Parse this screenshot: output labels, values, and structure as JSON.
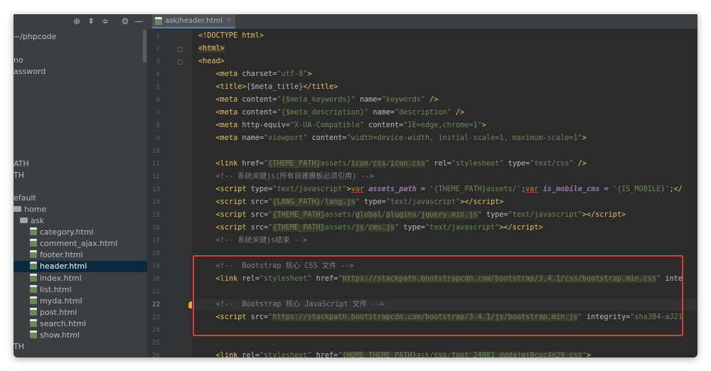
{
  "tab": {
    "label": "ask/header.html"
  },
  "project_tree": [
    {
      "label": "~/phpcode",
      "kind": "text"
    },
    {
      "label": "no",
      "kind": "text"
    },
    {
      "label": "assword",
      "kind": "text"
    },
    {
      "label": "ATH",
      "kind": "text"
    },
    {
      "label": "TH",
      "kind": "text"
    },
    {
      "label": "efault",
      "kind": "text"
    },
    {
      "label": "home",
      "kind": "folder"
    },
    {
      "label": "ask",
      "kind": "folder"
    },
    {
      "label": "category.html",
      "kind": "html"
    },
    {
      "label": "comment_ajax.html",
      "kind": "html"
    },
    {
      "label": "footer.html",
      "kind": "html"
    },
    {
      "label": "header.html",
      "kind": "html",
      "selected": true
    },
    {
      "label": "index.html",
      "kind": "html"
    },
    {
      "label": "list.html",
      "kind": "html"
    },
    {
      "label": "myda.html",
      "kind": "html"
    },
    {
      "label": "post.html",
      "kind": "html"
    },
    {
      "label": "search.html",
      "kind": "html"
    },
    {
      "label": "show.html",
      "kind": "html"
    },
    {
      "label": "TH",
      "kind": "text"
    }
  ],
  "editor": {
    "current_line": 22,
    "lines": [
      {
        "n": "1",
        "html": "<span class='t'>&lt;!DOCTYPE html&gt;</span>"
      },
      {
        "n": "2",
        "html": "<span class='t hl'>&lt;html&gt;</span>"
      },
      {
        "n": "3",
        "html": "<span class='t'>&lt;head&gt;</span>"
      },
      {
        "n": "4",
        "html": "    <span class='t'>&lt;meta </span><span class='a'>charset=</span><span class='s'>\"utf-8\"</span><span class='t'>&gt;</span>"
      },
      {
        "n": "5",
        "html": "    <span class='t'>&lt;title&gt;</span>{$meta_title}<span class='t'>&lt;/title&gt;</span>"
      },
      {
        "n": "6",
        "html": "    <span class='t'>&lt;meta </span><span class='a'>content=</span><span class='s'>\"{$meta_keywords}\" </span><span class='a'>name=</span><span class='s'>\"keywords\"</span><span class='t'> /&gt;</span>"
      },
      {
        "n": "7",
        "html": "    <span class='t'>&lt;meta </span><span class='a'>content=</span><span class='s'>\"{$meta_description}\" </span><span class='a'>name=</span><span class='s'>\"description\"</span><span class='t'> /&gt;</span>"
      },
      {
        "n": "8",
        "html": "    <span class='t'>&lt;meta </span><span class='a'>http-equiv=</span><span class='s'>\"X-UA-Compatible\" </span><span class='a'>content=</span><span class='s'>\"IE=edge,chrome=1\"</span><span class='t'>&gt;</span>"
      },
      {
        "n": "9",
        "html": "    <span class='t'>&lt;meta </span><span class='a'>name=</span><span class='s'>\"viewport\" </span><span class='a'>content=</span><span class='s'>\"width=device-width, initial-scale=1, maximum-scale=1\"</span><span class='t'>&gt;</span>"
      },
      {
        "n": "10",
        "html": ""
      },
      {
        "n": "11",
        "html": "    <span class='t'>&lt;link </span><span class='a'>href=</span><span class='s'>\"<span class='hl'>{THEME_PATH}</span>assets/<span class='hl'>icon</span>/<span class='hl'>css</span>/<span class='hl'>icon.css</span>\" </span><span class='a'>rel=</span><span class='s'>\"stylesheet\" </span><span class='a'>type=</span><span class='s'>\"text/css\"</span><span class='t'> /&gt;</span>"
      },
      {
        "n": "12",
        "html": "    <span class='c'>&lt;!-- 系统关键js(所有自建模板必须引用) --&gt;</span>"
      },
      {
        "n": "13",
        "html": "    <span class='t'>&lt;script </span><span class='a'>type=</span><span class='s'>\"text/javascript\"</span><span class='t'>&gt;</span><span class='k u'>var</span> <span class='v'>assets_path</span> = <span class='s'>'{THEME_PATH}assets/'</span>;<span class='k u'>var</span> <span class='v'>is_mobile_cms</span> = <span class='s'>'{IS_MOBILE}'</span>;<span class='t'>&lt;/</span>"
      },
      {
        "n": "14",
        "html": "    <span class='t'>&lt;script </span><span class='a'>src=</span><span class='s'>\"<span class='hl'>{LANG_PATH}</span>/<span class='hl'>lang.js</span>\" </span><span class='a'>type=</span><span class='s'>\"text/javascript\"</span><span class='t'>&gt;&lt;/script&gt;</span>"
      },
      {
        "n": "15",
        "html": "    <span class='t'>&lt;script </span><span class='a'>src=</span><span class='s'>\"<span class='hl'>{THEME_PATH}</span>assets/<span class='hl'>global</span>/<span class='hl'>plugins</span>/<span class='hl'>jquery.min.js</span>\" </span><span class='a'>type=</span><span class='s'>\"text/javascript\"</span><span class='t'>&gt;&lt;/script&gt;</span>"
      },
      {
        "n": "16",
        "html": "    <span class='t'>&lt;script </span><span class='a'>src=</span><span class='s'>\"<span class='hl'>{THEME_PATH}</span>assets/<span class='hl'>js</span>/<span class='hl'>cms.js</span>\" </span><span class='a'>type=</span><span class='s'>\"text/javascript\"</span><span class='t'>&gt;&lt;/script&gt;</span>"
      },
      {
        "n": "17",
        "html": "    <span class='c'>&lt;!-- 系统关键js结束 --&gt;</span>"
      },
      {
        "n": "18",
        "html": ""
      },
      {
        "n": "19",
        "html": "    <span class='c'>&lt;!--  Bootstrap 核心 CSS 文件 --&gt;</span>"
      },
      {
        "n": "20",
        "html": "    <span class='t'>&lt;link </span><span class='a'>rel=</span><span class='s'>\"stylesheet\" </span><span class='a'>href=</span><span class='s'>\"<span class='hl'>https://stackpath.bootstrapcdn.com/bootstrap/3.4.1/css/bootstrap.min.css</span>\" </span><span class='a'>inte</span>"
      },
      {
        "n": "21",
        "html": ""
      },
      {
        "n": "22",
        "html": "    <span class='c'>&lt;!--  Bootstrap 核心 JavaScript 文件 --&gt;</span>"
      },
      {
        "n": "23",
        "html": "    <span class='t'>&lt;script </span><span class='a'>src=</span><span class='s'>\"<span class='hl'>https://stackpath.bootstrapcdn.com/bootstrap/3.4.1/js/bootstrap.min.js</span>\" </span><span class='a'>integrity=</span><span class='s'>\"sha384-aJ21</span>"
      },
      {
        "n": "24",
        "html": ""
      },
      {
        "n": "25",
        "html": ""
      },
      {
        "n": "26",
        "html": "    <span class='t'>&lt;link </span><span class='a'>rel=</span><span class='s'>\"stylesheet\" </span><span class='a'>href=</span><span class='s'>\"<span class='hl'>{HOME_THEME_PATH}</span>ask/<span class='hl'>css</span>/<span class='hl'>font_24081_dddajmj0coc4n29.css</span>\"</span><span class='t'>&gt;</span>"
      }
    ]
  }
}
